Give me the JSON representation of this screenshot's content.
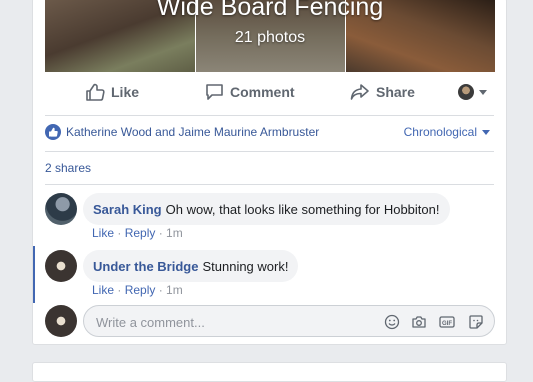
{
  "album": {
    "title": "Wide Board Fencing",
    "count": "21 photos"
  },
  "actions": {
    "like": "Like",
    "comment": "Comment",
    "share": "Share"
  },
  "reactions": {
    "text": "Katherine Wood and Jaime Maurine Armbruster",
    "order": "Chronological"
  },
  "shares": "2 shares",
  "comments": [
    {
      "author": "Sarah King",
      "text": "Oh wow, that looks like something for Hobbiton!",
      "like": "Like",
      "sep1": " · ",
      "reply": "Reply",
      "sep2": " · ",
      "time": "1m"
    },
    {
      "author": "Under the Bridge",
      "text": "Stunning work!",
      "like": "Like",
      "sep1": " · ",
      "reply": "Reply",
      "sep2": " · ",
      "time": "1m"
    }
  ],
  "composer": {
    "placeholder": "Write a comment..."
  },
  "colors": {
    "accent": "#4267b2",
    "link": "#385898",
    "muted": "#90949c"
  }
}
